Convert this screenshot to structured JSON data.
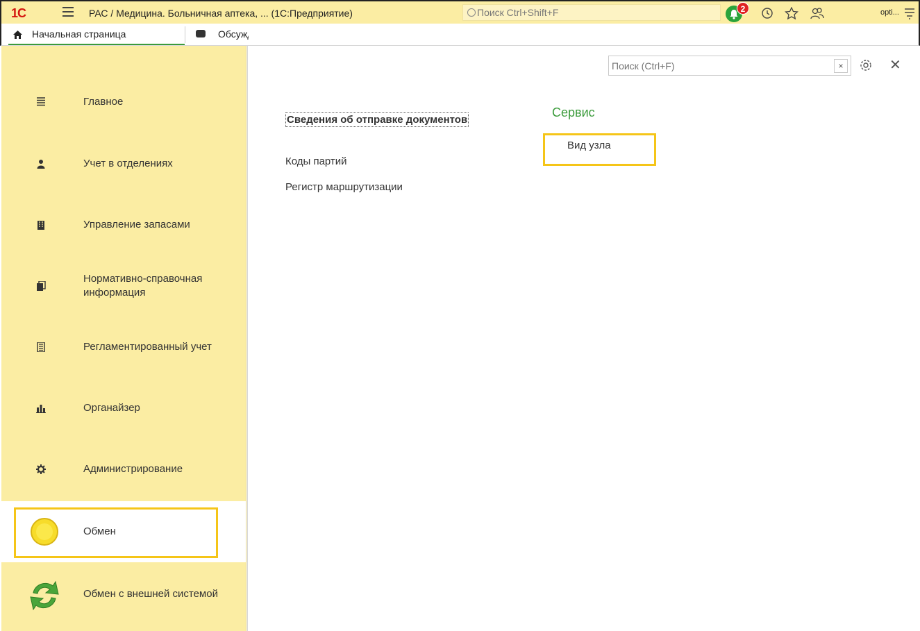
{
  "titlebar": {
    "logo": "1С",
    "title": "РАС / Медицина. Больничная аптека, ...  (1С:Предприятие)",
    "search_placeholder": "Поиск Ctrl+Shift+F",
    "notification_count": "2",
    "user": "opti...",
    "colors": {
      "bar": "#fbeda3",
      "logo": "#d4160f",
      "bell": "#2aa33a",
      "badge": "#e02222"
    }
  },
  "tabs": [
    {
      "label": "Начальная страница",
      "icon": "home-icon",
      "active": true
    },
    {
      "label": "Обсуждения",
      "icon": "discussion-icon",
      "active": false
    }
  ],
  "sidebar": {
    "items": [
      {
        "label": "Главное",
        "icon": "menu-lines-icon"
      },
      {
        "label": "Учет в отделениях",
        "icon": "person-icon"
      },
      {
        "label": "Управление запасами",
        "icon": "building-icon"
      },
      {
        "label": "Нормативно-справочная информация",
        "icon": "documents-icon"
      },
      {
        "label": "Регламентированный учет",
        "icon": "ledger-icon"
      },
      {
        "label": "Органайзер",
        "icon": "bar-chart-icon"
      },
      {
        "label": "Администрирование",
        "icon": "gear-icon"
      },
      {
        "label": "Обмен",
        "icon": "yellow-circle-icon",
        "active": true
      },
      {
        "label": "Обмен с внешней системой",
        "icon": "sync-arrows-icon"
      }
    ]
  },
  "content": {
    "search_placeholder": "Поиск (Ctrl+F)",
    "links": {
      "documents_sending": "Сведения об отправке документов",
      "batch_codes": "Коды партий",
      "routing_register": "Регистр маршрутизации"
    },
    "service": {
      "title": "Сервис",
      "node_type": "Вид узла"
    },
    "colors": {
      "accent": "#3b9b3b",
      "highlight": "#f5c518",
      "sidebar": "#fbeda3"
    }
  }
}
